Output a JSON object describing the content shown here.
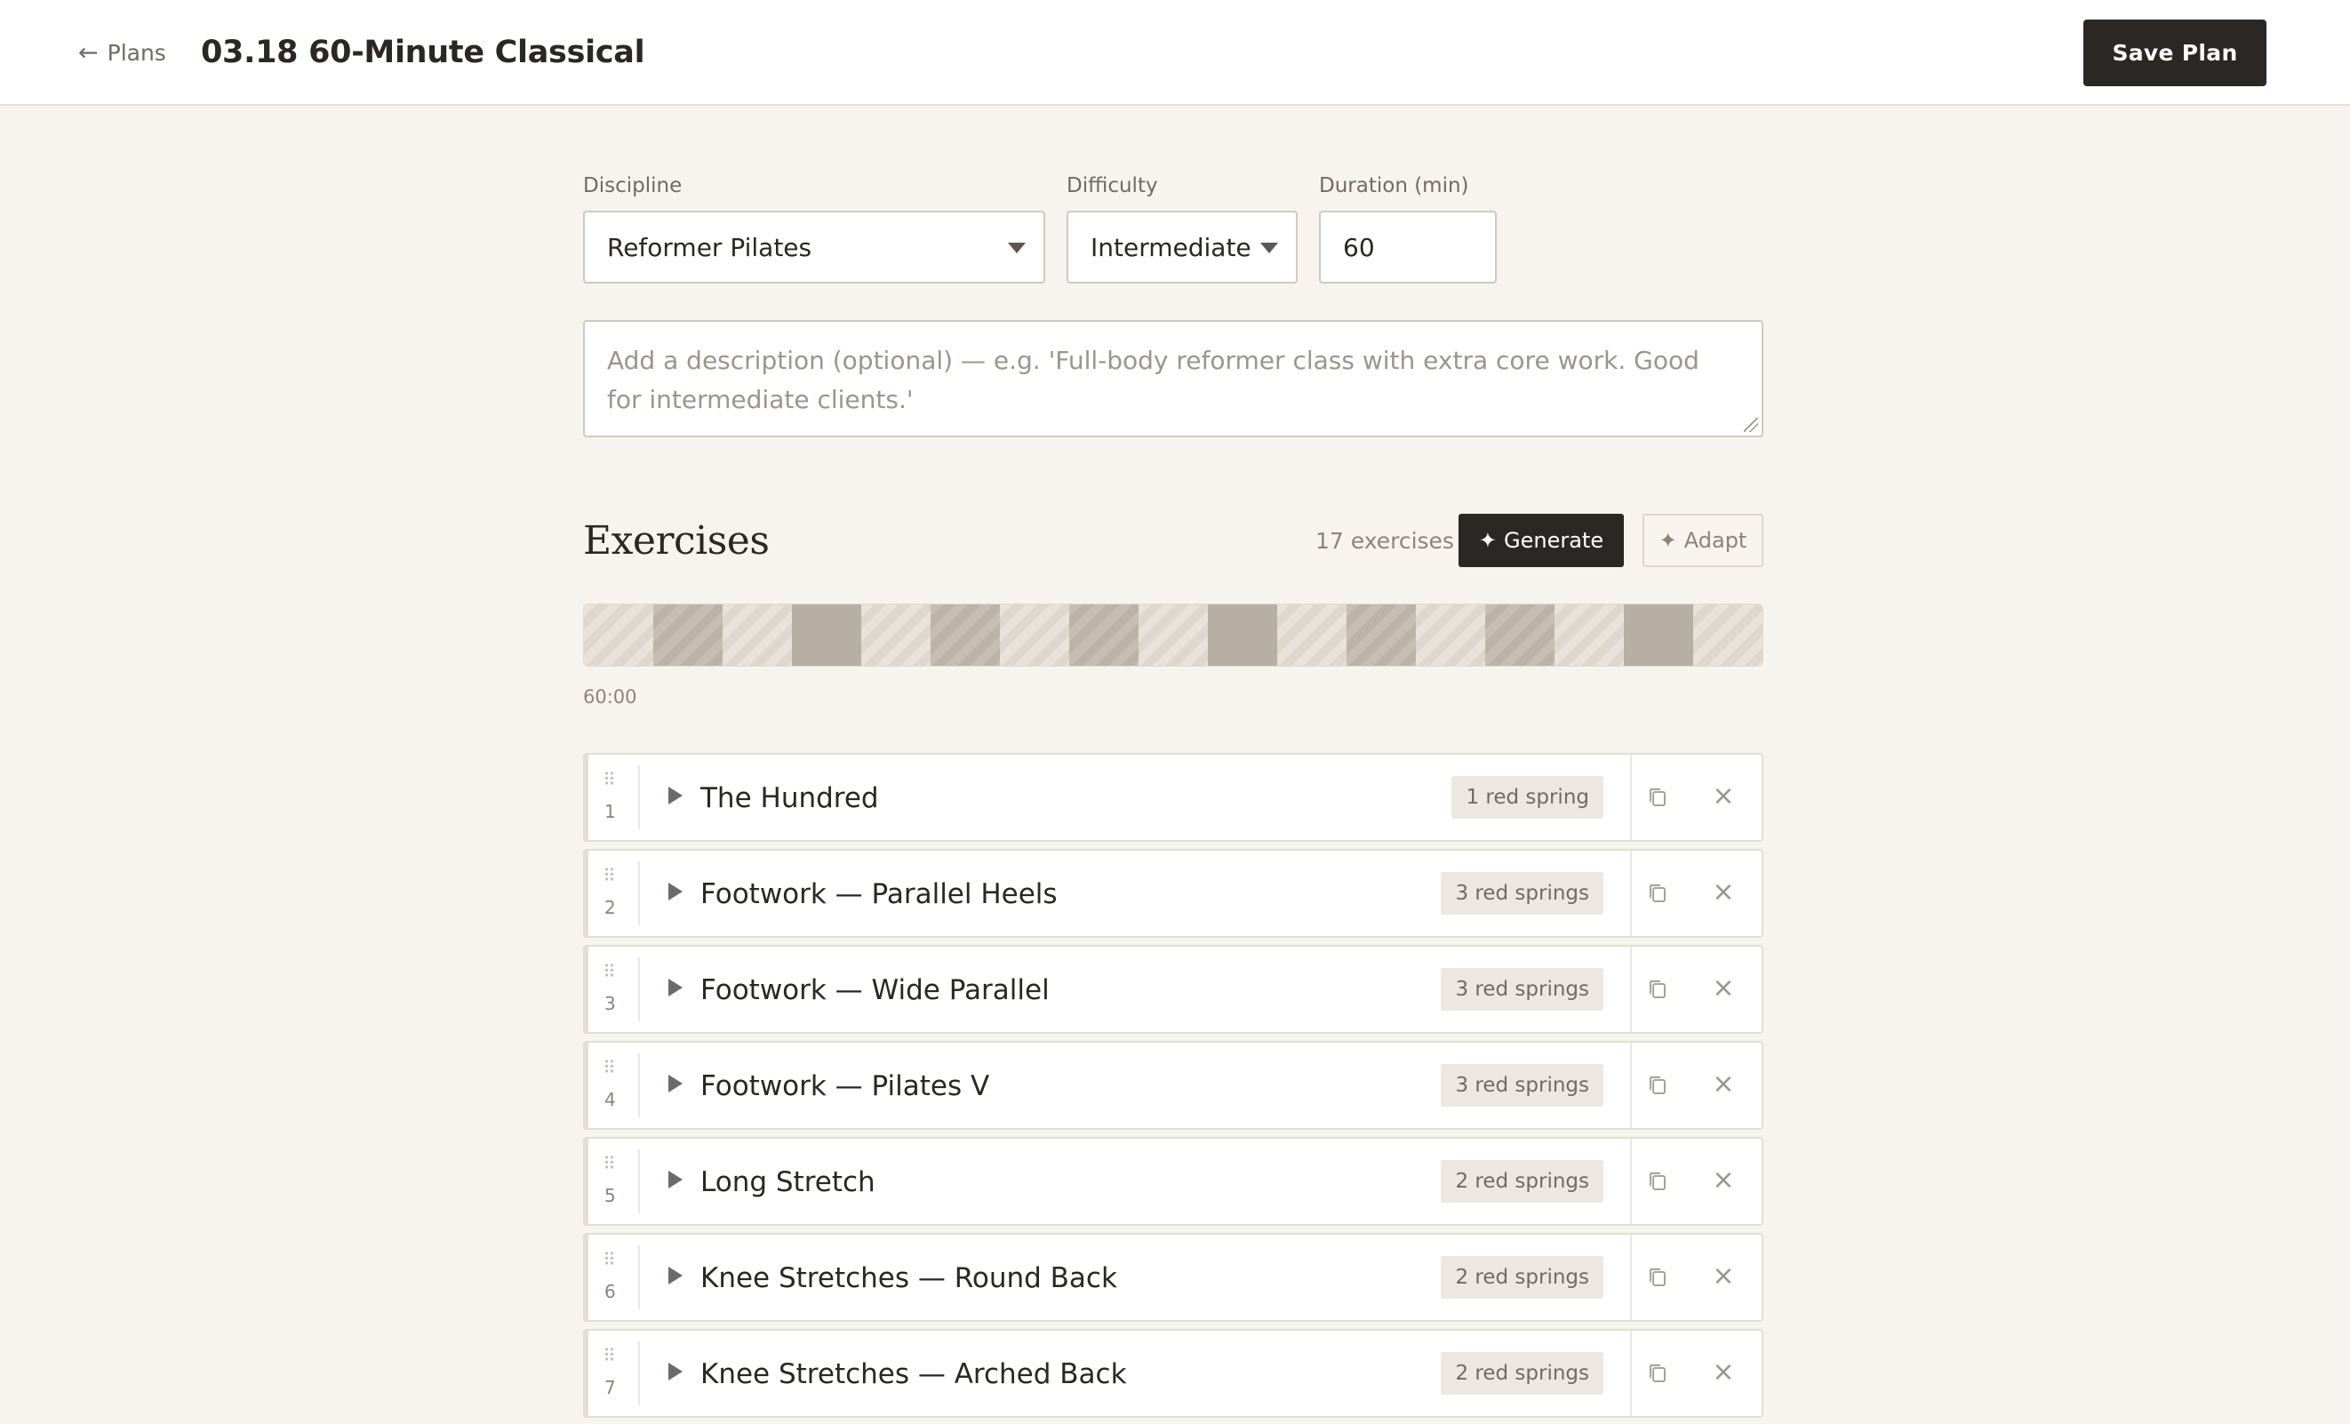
{
  "header": {
    "back_label": "Plans",
    "title": "03.18 60-Minute Classical",
    "save_label": "Save Plan"
  },
  "form": {
    "discipline_label": "Discipline",
    "discipline_value": "Reformer Pilates",
    "difficulty_label": "Difficulty",
    "difficulty_value": "Intermediate",
    "duration_label": "Duration (min)",
    "duration_value": "60",
    "description_placeholder": "Add a description (optional) — e.g. 'Full-body reformer class with extra core work. Good for intermediate clients.'"
  },
  "exercises": {
    "heading": "Exercises",
    "count_label": "17 exercises",
    "generate_label": "Generate",
    "adapt_label": "Adapt",
    "total_time": "60:00",
    "timeline_shades": [
      "light",
      "mid",
      "light",
      "dark",
      "light",
      "mid",
      "light",
      "mid",
      "light",
      "dark",
      "light",
      "mid",
      "light",
      "mid",
      "light",
      "dark",
      "light"
    ],
    "items": [
      {
        "num": "1",
        "name": "The Hundred",
        "spring": "1 red spring"
      },
      {
        "num": "2",
        "name": "Footwork — Parallel Heels",
        "spring": "3 red springs"
      },
      {
        "num": "3",
        "name": "Footwork — Wide Parallel",
        "spring": "3 red springs"
      },
      {
        "num": "4",
        "name": "Footwork — Pilates V",
        "spring": "3 red springs"
      },
      {
        "num": "5",
        "name": "Long Stretch",
        "spring": "2 red springs"
      },
      {
        "num": "6",
        "name": "Knee Stretches — Round Back",
        "spring": "2 red springs"
      },
      {
        "num": "7",
        "name": "Knee Stretches — Arched Back",
        "spring": "2 red springs"
      }
    ]
  },
  "icons": {
    "back": "arrow-left-icon",
    "caret": "chevron-down-icon",
    "sparkle": "sparkle-icon",
    "drag": "drag-handle-icon",
    "play": "play-icon",
    "duplicate": "duplicate-icon",
    "remove": "close-icon"
  }
}
